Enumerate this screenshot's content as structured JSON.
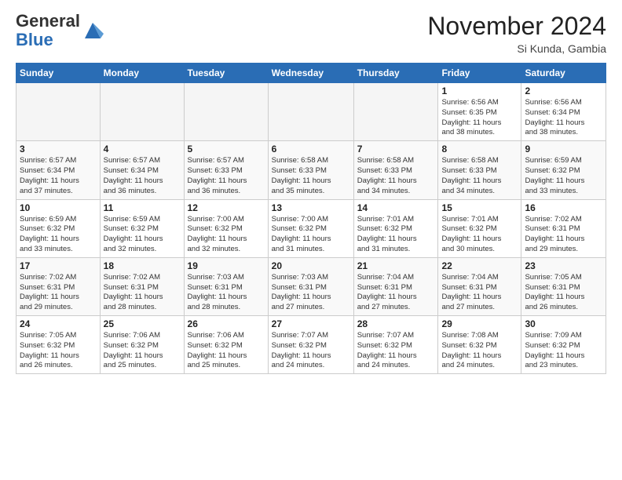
{
  "header": {
    "logo_line1": "General",
    "logo_line2": "Blue",
    "month": "November 2024",
    "location": "Si Kunda, Gambia"
  },
  "weekdays": [
    "Sunday",
    "Monday",
    "Tuesday",
    "Wednesday",
    "Thursday",
    "Friday",
    "Saturday"
  ],
  "weeks": [
    [
      {
        "day": "",
        "info": ""
      },
      {
        "day": "",
        "info": ""
      },
      {
        "day": "",
        "info": ""
      },
      {
        "day": "",
        "info": ""
      },
      {
        "day": "",
        "info": ""
      },
      {
        "day": "1",
        "info": "Sunrise: 6:56 AM\nSunset: 6:35 PM\nDaylight: 11 hours\nand 38 minutes."
      },
      {
        "day": "2",
        "info": "Sunrise: 6:56 AM\nSunset: 6:34 PM\nDaylight: 11 hours\nand 38 minutes."
      }
    ],
    [
      {
        "day": "3",
        "info": "Sunrise: 6:57 AM\nSunset: 6:34 PM\nDaylight: 11 hours\nand 37 minutes."
      },
      {
        "day": "4",
        "info": "Sunrise: 6:57 AM\nSunset: 6:34 PM\nDaylight: 11 hours\nand 36 minutes."
      },
      {
        "day": "5",
        "info": "Sunrise: 6:57 AM\nSunset: 6:33 PM\nDaylight: 11 hours\nand 36 minutes."
      },
      {
        "day": "6",
        "info": "Sunrise: 6:58 AM\nSunset: 6:33 PM\nDaylight: 11 hours\nand 35 minutes."
      },
      {
        "day": "7",
        "info": "Sunrise: 6:58 AM\nSunset: 6:33 PM\nDaylight: 11 hours\nand 34 minutes."
      },
      {
        "day": "8",
        "info": "Sunrise: 6:58 AM\nSunset: 6:33 PM\nDaylight: 11 hours\nand 34 minutes."
      },
      {
        "day": "9",
        "info": "Sunrise: 6:59 AM\nSunset: 6:32 PM\nDaylight: 11 hours\nand 33 minutes."
      }
    ],
    [
      {
        "day": "10",
        "info": "Sunrise: 6:59 AM\nSunset: 6:32 PM\nDaylight: 11 hours\nand 33 minutes."
      },
      {
        "day": "11",
        "info": "Sunrise: 6:59 AM\nSunset: 6:32 PM\nDaylight: 11 hours\nand 32 minutes."
      },
      {
        "day": "12",
        "info": "Sunrise: 7:00 AM\nSunset: 6:32 PM\nDaylight: 11 hours\nand 32 minutes."
      },
      {
        "day": "13",
        "info": "Sunrise: 7:00 AM\nSunset: 6:32 PM\nDaylight: 11 hours\nand 31 minutes."
      },
      {
        "day": "14",
        "info": "Sunrise: 7:01 AM\nSunset: 6:32 PM\nDaylight: 11 hours\nand 31 minutes."
      },
      {
        "day": "15",
        "info": "Sunrise: 7:01 AM\nSunset: 6:32 PM\nDaylight: 11 hours\nand 30 minutes."
      },
      {
        "day": "16",
        "info": "Sunrise: 7:02 AM\nSunset: 6:31 PM\nDaylight: 11 hours\nand 29 minutes."
      }
    ],
    [
      {
        "day": "17",
        "info": "Sunrise: 7:02 AM\nSunset: 6:31 PM\nDaylight: 11 hours\nand 29 minutes."
      },
      {
        "day": "18",
        "info": "Sunrise: 7:02 AM\nSunset: 6:31 PM\nDaylight: 11 hours\nand 28 minutes."
      },
      {
        "day": "19",
        "info": "Sunrise: 7:03 AM\nSunset: 6:31 PM\nDaylight: 11 hours\nand 28 minutes."
      },
      {
        "day": "20",
        "info": "Sunrise: 7:03 AM\nSunset: 6:31 PM\nDaylight: 11 hours\nand 27 minutes."
      },
      {
        "day": "21",
        "info": "Sunrise: 7:04 AM\nSunset: 6:31 PM\nDaylight: 11 hours\nand 27 minutes."
      },
      {
        "day": "22",
        "info": "Sunrise: 7:04 AM\nSunset: 6:31 PM\nDaylight: 11 hours\nand 27 minutes."
      },
      {
        "day": "23",
        "info": "Sunrise: 7:05 AM\nSunset: 6:31 PM\nDaylight: 11 hours\nand 26 minutes."
      }
    ],
    [
      {
        "day": "24",
        "info": "Sunrise: 7:05 AM\nSunset: 6:32 PM\nDaylight: 11 hours\nand 26 minutes."
      },
      {
        "day": "25",
        "info": "Sunrise: 7:06 AM\nSunset: 6:32 PM\nDaylight: 11 hours\nand 25 minutes."
      },
      {
        "day": "26",
        "info": "Sunrise: 7:06 AM\nSunset: 6:32 PM\nDaylight: 11 hours\nand 25 minutes."
      },
      {
        "day": "27",
        "info": "Sunrise: 7:07 AM\nSunset: 6:32 PM\nDaylight: 11 hours\nand 24 minutes."
      },
      {
        "day": "28",
        "info": "Sunrise: 7:07 AM\nSunset: 6:32 PM\nDaylight: 11 hours\nand 24 minutes."
      },
      {
        "day": "29",
        "info": "Sunrise: 7:08 AM\nSunset: 6:32 PM\nDaylight: 11 hours\nand 24 minutes."
      },
      {
        "day": "30",
        "info": "Sunrise: 7:09 AM\nSunset: 6:32 PM\nDaylight: 11 hours\nand 23 minutes."
      }
    ]
  ]
}
